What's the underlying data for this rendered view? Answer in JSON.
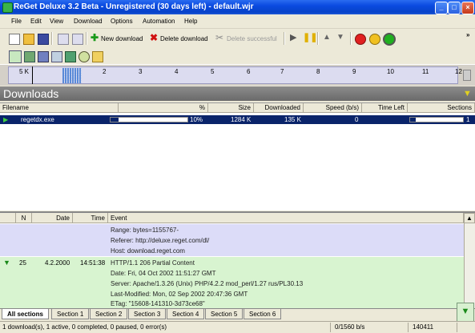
{
  "window": {
    "title": "ReGet Deluxe 3.2 Beta - Unregistered (30 days left) - default.wjr"
  },
  "menu": [
    "File",
    "Edit",
    "View",
    "Download",
    "Options",
    "Automation",
    "Help"
  ],
  "toolbar": {
    "new_download": "New download",
    "delete_download": "Delete download",
    "delete_successful": "Delete successful",
    "overflow": "»"
  },
  "timeline": {
    "labels": [
      "5 K",
      "2",
      "3",
      "4",
      "5",
      "6",
      "7",
      "8",
      "9",
      "10",
      "11",
      "12"
    ]
  },
  "downloads": {
    "header": "Downloads",
    "columns": [
      "Filename",
      "%",
      "Size",
      "Downloaded",
      "Speed (b/s)",
      "Time Left",
      "Sections"
    ],
    "rows": [
      {
        "filename": "regetdx.exe",
        "percent_text": "10%",
        "percent": 10,
        "size": "1284 K",
        "downloaded": "135 K",
        "speed": "0",
        "time_left": "",
        "sections": "1"
      }
    ]
  },
  "log": {
    "columns": [
      "N",
      "Date",
      "Time",
      "Event"
    ],
    "block1": [
      "Range: bytes=1155767-",
      "Referer: http://deluxe.reget.com/dl/",
      "Host: download.reget.com"
    ],
    "entry": {
      "n": "25",
      "date": "4.2.2000",
      "time": "14:51:38"
    },
    "block2": [
      "HTTP/1.1 206 Partial Content",
      "Date: Fri, 04 Oct 2002 11:51:27 GMT",
      "Server: Apache/1.3.26 (Unix) PHP/4.2.2 mod_perl/1.27 rus/PL30.13",
      "Last-Modified: Mon, 02 Sep 2002 20:47:36 GMT",
      "ETag: \"15608-141310-3d73ce68\""
    ]
  },
  "tabs": [
    "All sections",
    "Section 1",
    "Section 2",
    "Section 3",
    "Section 4",
    "Section 5",
    "Section 6"
  ],
  "status": {
    "summary": "1 download(s), 1 active, 0 completed, 0 paused, 0 error(s)",
    "speed": "0/1560 b/s",
    "bytes": "140411"
  },
  "colors": {
    "title_blue": "#0a4ae0",
    "selection": "#0a246a",
    "log_blue": "#dcdcf8",
    "log_green": "#d8f4d0",
    "green_arrow": "#1a8a1a"
  }
}
